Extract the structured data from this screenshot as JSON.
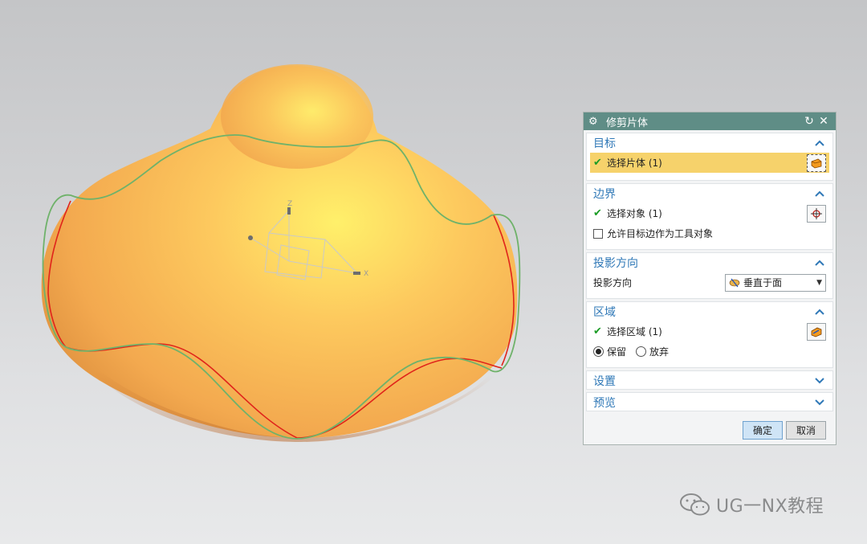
{
  "dialog": {
    "title": "修剪片体",
    "sections": {
      "target": {
        "label": "目标",
        "select_body": "选择片体 (1)"
      },
      "boundary": {
        "label": "边界",
        "select_object": "选择对象 (1)",
        "allow_edges": "允许目标边作为工具对象"
      },
      "projection": {
        "label": "投影方向",
        "field_label": "投影方向",
        "selected": "垂直于面"
      },
      "region": {
        "label": "区域",
        "select_region": "选择区域 (1)",
        "keep": "保留",
        "discard": "放弃"
      },
      "settings": {
        "label": "设置"
      },
      "preview": {
        "label": "预览"
      }
    },
    "ok": "确定",
    "cancel": "取消"
  },
  "axes": {
    "z": "Z",
    "x": "X"
  },
  "watermark": "UG一NX教程",
  "colors": {
    "title_bar": "#5f8d86",
    "section_header": "#2f78b7",
    "selected_row": "#f6d26b",
    "surface": "#f5b65a",
    "boundary_curve": "#6fb26a",
    "trim_edge": "#e0241b"
  },
  "icons": {
    "title": "gear-icon",
    "reset": "reset-icon",
    "close": "close-icon",
    "collapse": "chevron-up-icon",
    "expand": "chevron-down-icon",
    "check": "check-icon",
    "sheet_body": "sheet-body-icon",
    "crosshair": "crosshair-icon",
    "region": "region-icon",
    "projection": "projection-icon",
    "watermark": "wechat-icon"
  }
}
